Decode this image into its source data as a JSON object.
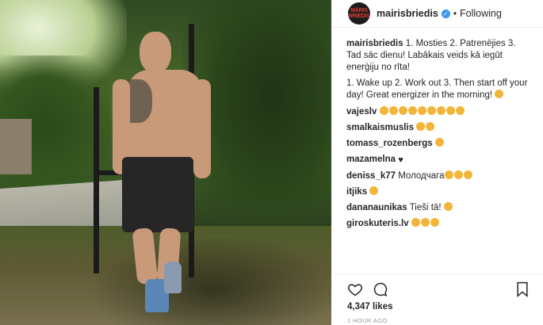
{
  "post": {
    "avatar_text": "MĀRIS BRIEDIS",
    "username": "mairisbriedis",
    "verified_glyph": "✓",
    "separator": "•",
    "follow_status": "Following"
  },
  "caption": {
    "user": "mairisbriedis",
    "text": "1. Mosties 2. Patrenējies 3. Tad sāc dienu! Labākais veids kā iegūt enerģiju no rīta!"
  },
  "translation": "1. Wake up 2. Work out 3. Then start off your day! Great energizer in the morning!",
  "comments": [
    {
      "user": "vajeslv",
      "text": "",
      "emoji_count": 9
    },
    {
      "user": "smalkaismuslis",
      "text": "",
      "emoji_count": 2
    },
    {
      "user": "tomass_rozenbergs",
      "text": "",
      "emoji_count": 1
    },
    {
      "user": "mazamelna",
      "text": "",
      "emoji_count": 0,
      "heart": "♥"
    },
    {
      "user": "deniss_k77",
      "text": "Молодчага",
      "emoji_count": 3
    },
    {
      "user": "itjiks",
      "text": "",
      "emoji_count": 1
    },
    {
      "user": "dananaunikas",
      "text": "Tieši tā!",
      "emoji_count": 1
    },
    {
      "user": "giroskuteris.lv",
      "text": "",
      "emoji_count": 3
    }
  ],
  "icons": {
    "like": "heart-outline-icon",
    "comment": "comment-bubble-icon",
    "save": "bookmark-icon"
  },
  "likes": "4,347 likes",
  "time_ago": "1 HOUR AGO"
}
